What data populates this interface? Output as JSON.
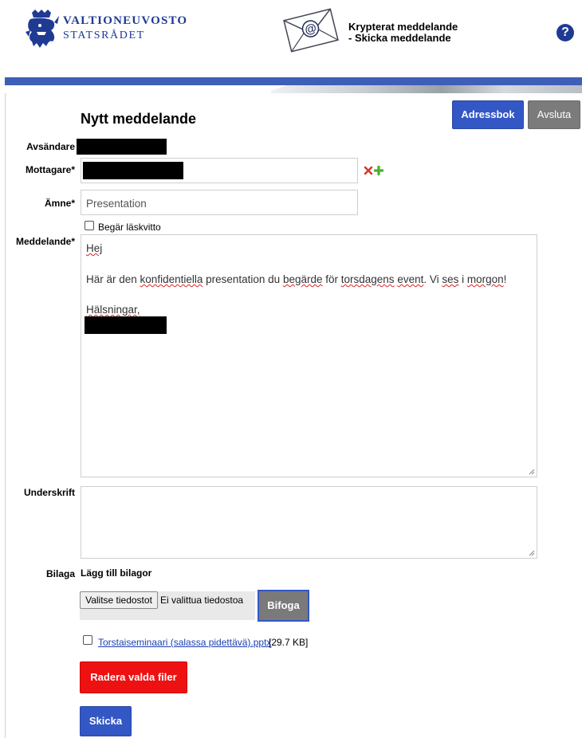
{
  "header": {
    "brand_line1": "VALTIONEUVOSTO",
    "brand_line2": "STATSRÅDET",
    "title_line1": "Krypterat meddelande",
    "title_line2": "- Skicka meddelande",
    "help_symbol": "?"
  },
  "toolbar": {
    "addressbook_label": "Adressbok",
    "logout_label": "Avsluta"
  },
  "form": {
    "heading": "Nytt meddelande",
    "sender_label": "Avsändare",
    "recipient_label": "Mottagare*",
    "subject_label": "Ämne*",
    "subject_value": "Presentation",
    "read_receipt_label": "Begär läskvitto",
    "message_label": "Meddelande*",
    "message": {
      "greeting": "Hej",
      "body_parts": [
        "Här är den ",
        "konfidentiella",
        " presentation du ",
        "begärde",
        " för ",
        "torsdagens",
        " ",
        "event",
        ". Vi ",
        "ses",
        " i ",
        "morgon",
        "!"
      ],
      "closing": "Hälsningar,"
    },
    "signature_label": "Underskrift",
    "attachment_label": "Bilaga",
    "add_attachments_label": "Lägg till bilagor",
    "choose_files_label": "Valitse tiedostot",
    "no_file_chosen": "Ei valittua tiedostoa",
    "attach_button": "Bifoga",
    "attachment_file_name": "Torstaiseminaari (salassa pidettävä).pptx",
    "attachment_file_size": "[29.7 KB]",
    "delete_selected_button": "Radera valda filer",
    "send_button": "Skicka"
  },
  "colors": {
    "brand_blue": "#1f3a93",
    "primary_button": "#3357c4",
    "secondary_button": "#7b7b7b",
    "danger_button": "#ee1111"
  }
}
